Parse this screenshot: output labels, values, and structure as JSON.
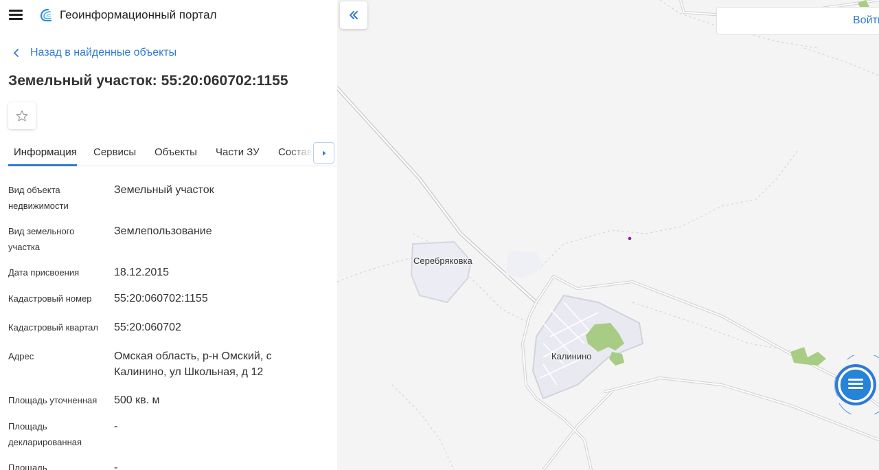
{
  "header": {
    "app_title": "Геоинформационный портал",
    "menu_icon": "hamburger-menu-icon",
    "logo_icon": "portal-logo-icon"
  },
  "back_link": {
    "label": "Назад в найденные объекты",
    "icon": "chevron-left-icon"
  },
  "page_title": "Земельный участок: 55:20:060702:1155",
  "favorite": {
    "icon": "star-outline-icon"
  },
  "tabs": [
    {
      "label": "Информация",
      "active": true
    },
    {
      "label": "Сервисы",
      "active": false
    },
    {
      "label": "Объекты",
      "active": false
    },
    {
      "label": "Части ЗУ",
      "active": false
    },
    {
      "label": "Состав",
      "active": false
    }
  ],
  "tabs_scroll_icon": "caret-right-icon",
  "details": [
    {
      "label": "Вид объекта недвижимости",
      "value": "Земельный участок"
    },
    {
      "label": "Вид земельного участка",
      "value": "Землепользование"
    },
    {
      "label": "Дата присвоения",
      "value": "18.12.2015"
    },
    {
      "label": "Кадастровый номер",
      "value": "55:20:060702:1155"
    },
    {
      "label": "Кадастровый квартал",
      "value": "55:20:060702"
    },
    {
      "label": "Адрес",
      "value": "Омская область, р-н Омский, с Калинино, ул Школьная, д 12"
    },
    {
      "label": "Площадь уточненная",
      "value": "500 кв. м"
    },
    {
      "label": "Площадь декларированная",
      "value": "-"
    },
    {
      "label": "Площадь",
      "value": "-"
    }
  ],
  "map": {
    "collapse_icon": "double-chevron-left-icon",
    "login_label": "Войти",
    "places": [
      {
        "name": "Серебряковка"
      },
      {
        "name": "Калинино"
      }
    ],
    "chat_icon": "chat-bubble-icon",
    "accent_color": "#2d7ad6",
    "vegetation_color": "#a9cc84",
    "marker_color": "#8a1fa8"
  }
}
